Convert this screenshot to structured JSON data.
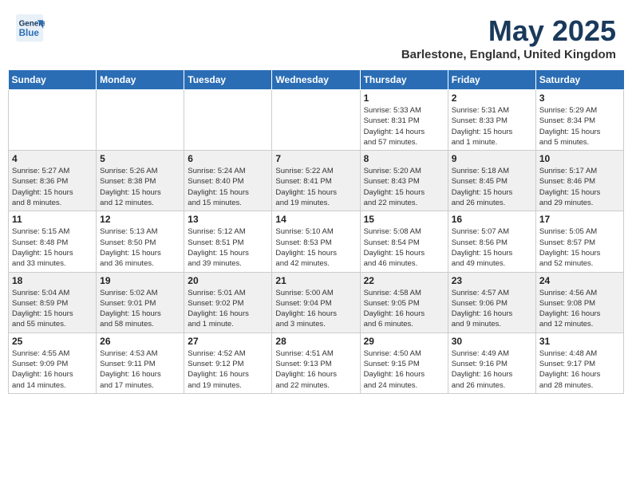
{
  "header": {
    "logo_line1": "General",
    "logo_line2": "Blue",
    "month": "May 2025",
    "location": "Barlestone, England, United Kingdom"
  },
  "days_of_week": [
    "Sunday",
    "Monday",
    "Tuesday",
    "Wednesday",
    "Thursday",
    "Friday",
    "Saturday"
  ],
  "weeks": [
    [
      {
        "day": "",
        "info": ""
      },
      {
        "day": "",
        "info": ""
      },
      {
        "day": "",
        "info": ""
      },
      {
        "day": "",
        "info": ""
      },
      {
        "day": "1",
        "info": "Sunrise: 5:33 AM\nSunset: 8:31 PM\nDaylight: 14 hours\nand 57 minutes."
      },
      {
        "day": "2",
        "info": "Sunrise: 5:31 AM\nSunset: 8:33 PM\nDaylight: 15 hours\nand 1 minute."
      },
      {
        "day": "3",
        "info": "Sunrise: 5:29 AM\nSunset: 8:34 PM\nDaylight: 15 hours\nand 5 minutes."
      }
    ],
    [
      {
        "day": "4",
        "info": "Sunrise: 5:27 AM\nSunset: 8:36 PM\nDaylight: 15 hours\nand 8 minutes."
      },
      {
        "day": "5",
        "info": "Sunrise: 5:26 AM\nSunset: 8:38 PM\nDaylight: 15 hours\nand 12 minutes."
      },
      {
        "day": "6",
        "info": "Sunrise: 5:24 AM\nSunset: 8:40 PM\nDaylight: 15 hours\nand 15 minutes."
      },
      {
        "day": "7",
        "info": "Sunrise: 5:22 AM\nSunset: 8:41 PM\nDaylight: 15 hours\nand 19 minutes."
      },
      {
        "day": "8",
        "info": "Sunrise: 5:20 AM\nSunset: 8:43 PM\nDaylight: 15 hours\nand 22 minutes."
      },
      {
        "day": "9",
        "info": "Sunrise: 5:18 AM\nSunset: 8:45 PM\nDaylight: 15 hours\nand 26 minutes."
      },
      {
        "day": "10",
        "info": "Sunrise: 5:17 AM\nSunset: 8:46 PM\nDaylight: 15 hours\nand 29 minutes."
      }
    ],
    [
      {
        "day": "11",
        "info": "Sunrise: 5:15 AM\nSunset: 8:48 PM\nDaylight: 15 hours\nand 33 minutes."
      },
      {
        "day": "12",
        "info": "Sunrise: 5:13 AM\nSunset: 8:50 PM\nDaylight: 15 hours\nand 36 minutes."
      },
      {
        "day": "13",
        "info": "Sunrise: 5:12 AM\nSunset: 8:51 PM\nDaylight: 15 hours\nand 39 minutes."
      },
      {
        "day": "14",
        "info": "Sunrise: 5:10 AM\nSunset: 8:53 PM\nDaylight: 15 hours\nand 42 minutes."
      },
      {
        "day": "15",
        "info": "Sunrise: 5:08 AM\nSunset: 8:54 PM\nDaylight: 15 hours\nand 46 minutes."
      },
      {
        "day": "16",
        "info": "Sunrise: 5:07 AM\nSunset: 8:56 PM\nDaylight: 15 hours\nand 49 minutes."
      },
      {
        "day": "17",
        "info": "Sunrise: 5:05 AM\nSunset: 8:57 PM\nDaylight: 15 hours\nand 52 minutes."
      }
    ],
    [
      {
        "day": "18",
        "info": "Sunrise: 5:04 AM\nSunset: 8:59 PM\nDaylight: 15 hours\nand 55 minutes."
      },
      {
        "day": "19",
        "info": "Sunrise: 5:02 AM\nSunset: 9:01 PM\nDaylight: 15 hours\nand 58 minutes."
      },
      {
        "day": "20",
        "info": "Sunrise: 5:01 AM\nSunset: 9:02 PM\nDaylight: 16 hours\nand 1 minute."
      },
      {
        "day": "21",
        "info": "Sunrise: 5:00 AM\nSunset: 9:04 PM\nDaylight: 16 hours\nand 3 minutes."
      },
      {
        "day": "22",
        "info": "Sunrise: 4:58 AM\nSunset: 9:05 PM\nDaylight: 16 hours\nand 6 minutes."
      },
      {
        "day": "23",
        "info": "Sunrise: 4:57 AM\nSunset: 9:06 PM\nDaylight: 16 hours\nand 9 minutes."
      },
      {
        "day": "24",
        "info": "Sunrise: 4:56 AM\nSunset: 9:08 PM\nDaylight: 16 hours\nand 12 minutes."
      }
    ],
    [
      {
        "day": "25",
        "info": "Sunrise: 4:55 AM\nSunset: 9:09 PM\nDaylight: 16 hours\nand 14 minutes."
      },
      {
        "day": "26",
        "info": "Sunrise: 4:53 AM\nSunset: 9:11 PM\nDaylight: 16 hours\nand 17 minutes."
      },
      {
        "day": "27",
        "info": "Sunrise: 4:52 AM\nSunset: 9:12 PM\nDaylight: 16 hours\nand 19 minutes."
      },
      {
        "day": "28",
        "info": "Sunrise: 4:51 AM\nSunset: 9:13 PM\nDaylight: 16 hours\nand 22 minutes."
      },
      {
        "day": "29",
        "info": "Sunrise: 4:50 AM\nSunset: 9:15 PM\nDaylight: 16 hours\nand 24 minutes."
      },
      {
        "day": "30",
        "info": "Sunrise: 4:49 AM\nSunset: 9:16 PM\nDaylight: 16 hours\nand 26 minutes."
      },
      {
        "day": "31",
        "info": "Sunrise: 4:48 AM\nSunset: 9:17 PM\nDaylight: 16 hours\nand 28 minutes."
      }
    ]
  ]
}
